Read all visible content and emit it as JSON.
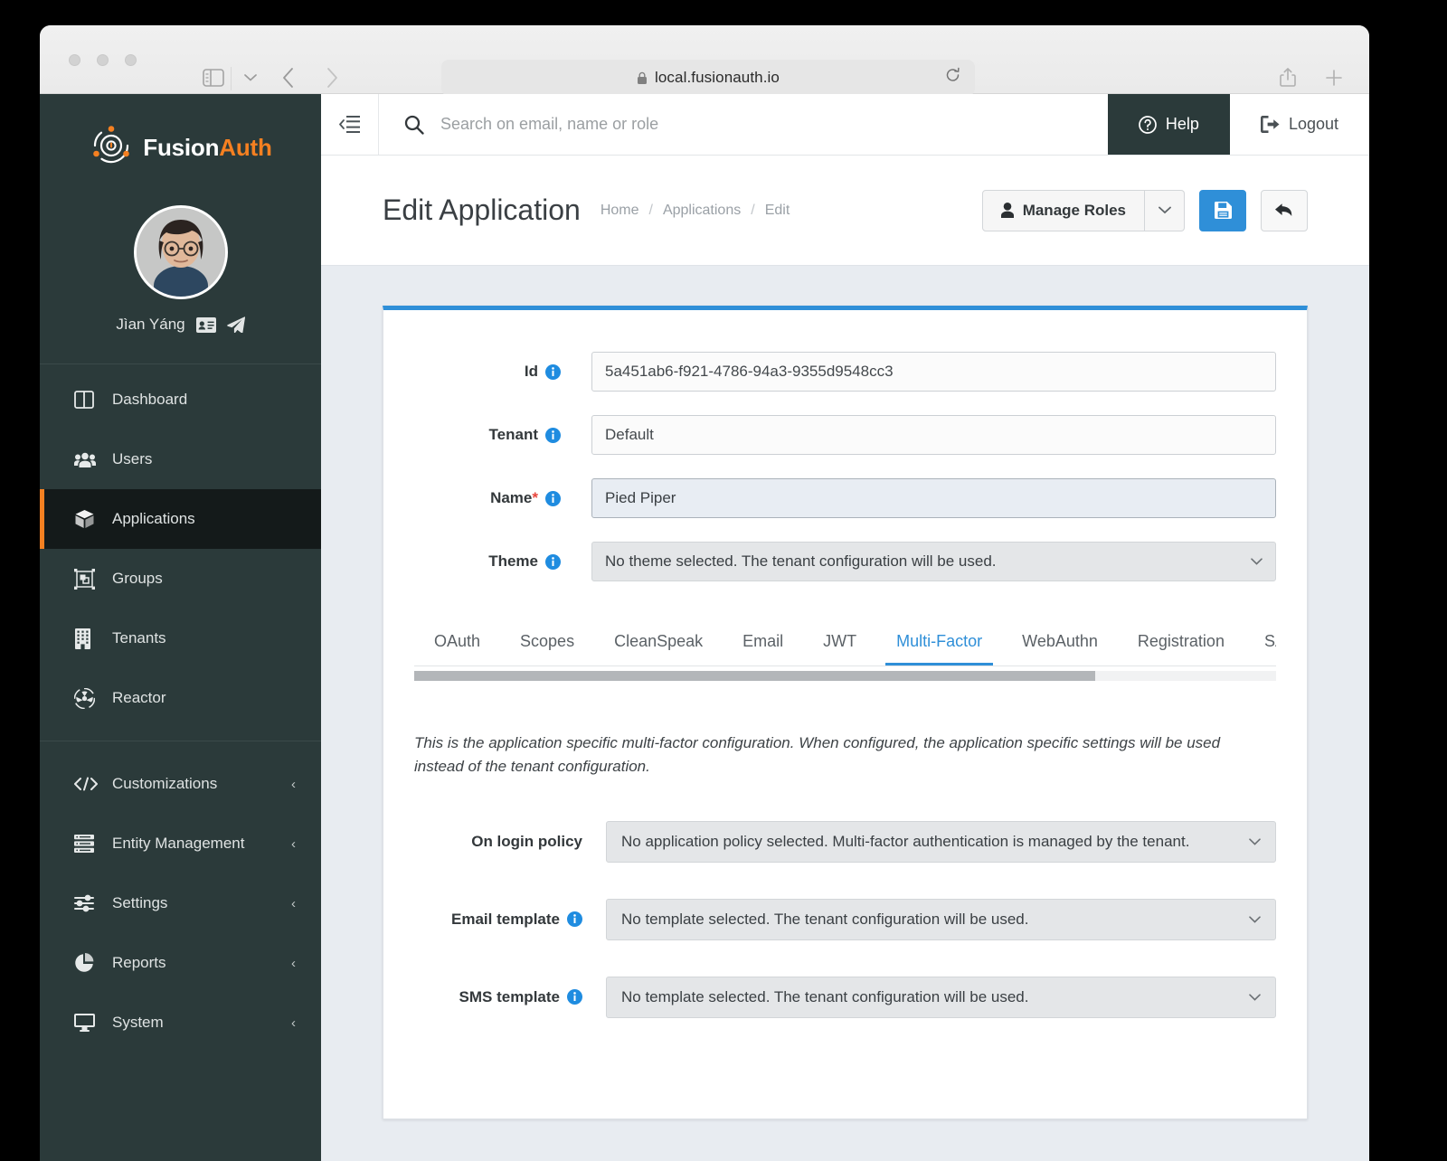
{
  "browser": {
    "url": "local.fusionauth.io",
    "lock_icon": "lock-icon",
    "reload_icon": "reload-icon",
    "back_icon": "back-arrow-icon",
    "forward_icon": "forward-arrow-icon",
    "sidebar_icon": "sidebar-toggle-icon",
    "share_icon": "share-icon",
    "newtab_icon": "plus-icon",
    "tabs_icon": "tab-overview-icon"
  },
  "sidebar": {
    "brand_first": "Fusion",
    "brand_second": "Auth",
    "user_name": "Jìan Yáng",
    "user_icons": [
      "id-card-icon",
      "paper-plane-icon"
    ],
    "items": [
      {
        "label": "Dashboard",
        "icon": "dashboard-icon",
        "active": false,
        "caret": ""
      },
      {
        "label": "Users",
        "icon": "users-icon",
        "active": false,
        "caret": ""
      },
      {
        "label": "Applications",
        "icon": "box-icon",
        "active": true,
        "caret": ""
      },
      {
        "label": "Groups",
        "icon": "groups-icon",
        "active": false,
        "caret": ""
      },
      {
        "label": "Tenants",
        "icon": "building-icon",
        "active": false,
        "caret": ""
      },
      {
        "label": "Reactor",
        "icon": "reactor-icon",
        "active": false,
        "caret": ""
      }
    ],
    "items2": [
      {
        "label": "Customizations",
        "icon": "code-icon",
        "active": false,
        "caret": "‹"
      },
      {
        "label": "Entity Management",
        "icon": "server-icon",
        "active": false,
        "caret": "‹"
      },
      {
        "label": "Settings",
        "icon": "sliders-icon",
        "active": false,
        "caret": "‹"
      },
      {
        "label": "Reports",
        "icon": "pie-chart-icon",
        "active": false,
        "caret": "‹"
      },
      {
        "label": "System",
        "icon": "monitor-icon",
        "active": false,
        "caret": "‹"
      }
    ]
  },
  "topbar": {
    "hamburger_icon": "menu-collapse-icon",
    "search_placeholder": "Search on email, name or role",
    "search_value": "",
    "search_icon": "search-icon",
    "help_label": "Help",
    "help_icon": "question-circle-icon",
    "logout_label": "Logout",
    "logout_icon": "sign-out-icon"
  },
  "header": {
    "title": "Edit Application",
    "breadcrumb": [
      "Home",
      "Applications",
      "Edit"
    ],
    "breadcrumb_sep": "/",
    "manage_roles_label": "Manage Roles",
    "manage_roles_icon": "user-icon",
    "manage_roles_caret": "chevron-down-icon",
    "save_icon": "save-icon",
    "cancel_icon": "undo-arrow-icon"
  },
  "form": {
    "fields": [
      {
        "label": "Id",
        "required": false,
        "info": true,
        "value": "5a451ab6-f921-4786-94a3-9355d9548cc3",
        "type": "text",
        "state": "readonly"
      },
      {
        "label": "Tenant",
        "required": false,
        "info": true,
        "value": "Default",
        "type": "text",
        "state": "readonly"
      },
      {
        "label": "Name",
        "required": true,
        "info": true,
        "value": "Pied Piper",
        "type": "text",
        "state": "focused"
      },
      {
        "label": "Theme",
        "required": false,
        "info": true,
        "value": "No theme selected. The tenant configuration will be used.",
        "type": "select",
        "state": "select"
      }
    ]
  },
  "tabs": {
    "items": [
      {
        "label": "OAuth",
        "active": false
      },
      {
        "label": "Scopes",
        "active": false
      },
      {
        "label": "CleanSpeak",
        "active": false
      },
      {
        "label": "Email",
        "active": false
      },
      {
        "label": "JWT",
        "active": false
      },
      {
        "label": "Multi-Factor",
        "active": true
      },
      {
        "label": "WebAuthn",
        "active": false
      },
      {
        "label": "Registration",
        "active": false
      },
      {
        "label": "SAML",
        "active": false
      }
    ],
    "scroll_percent": 79
  },
  "multifactor": {
    "description": "This is the application specific multi-factor configuration. When configured, the application specific settings will be used instead of the tenant configuration.",
    "rows": [
      {
        "label": "On login policy",
        "info": false,
        "value": "No application policy selected. Multi-factor authentication is managed by the tenant."
      },
      {
        "label": "Email template",
        "info": true,
        "value": "No template selected. The tenant configuration will be used."
      },
      {
        "label": "SMS template",
        "info": true,
        "value": "No template selected. The tenant configuration will be used."
      }
    ]
  },
  "colors": {
    "brand_orange": "#f58021",
    "accent_blue": "#2f8fd8",
    "sidebar_bg": "#2b3a3a",
    "sidebar_active_bg": "#141a1a",
    "page_bg": "#e8ecf1",
    "required_red": "#e8453c"
  }
}
